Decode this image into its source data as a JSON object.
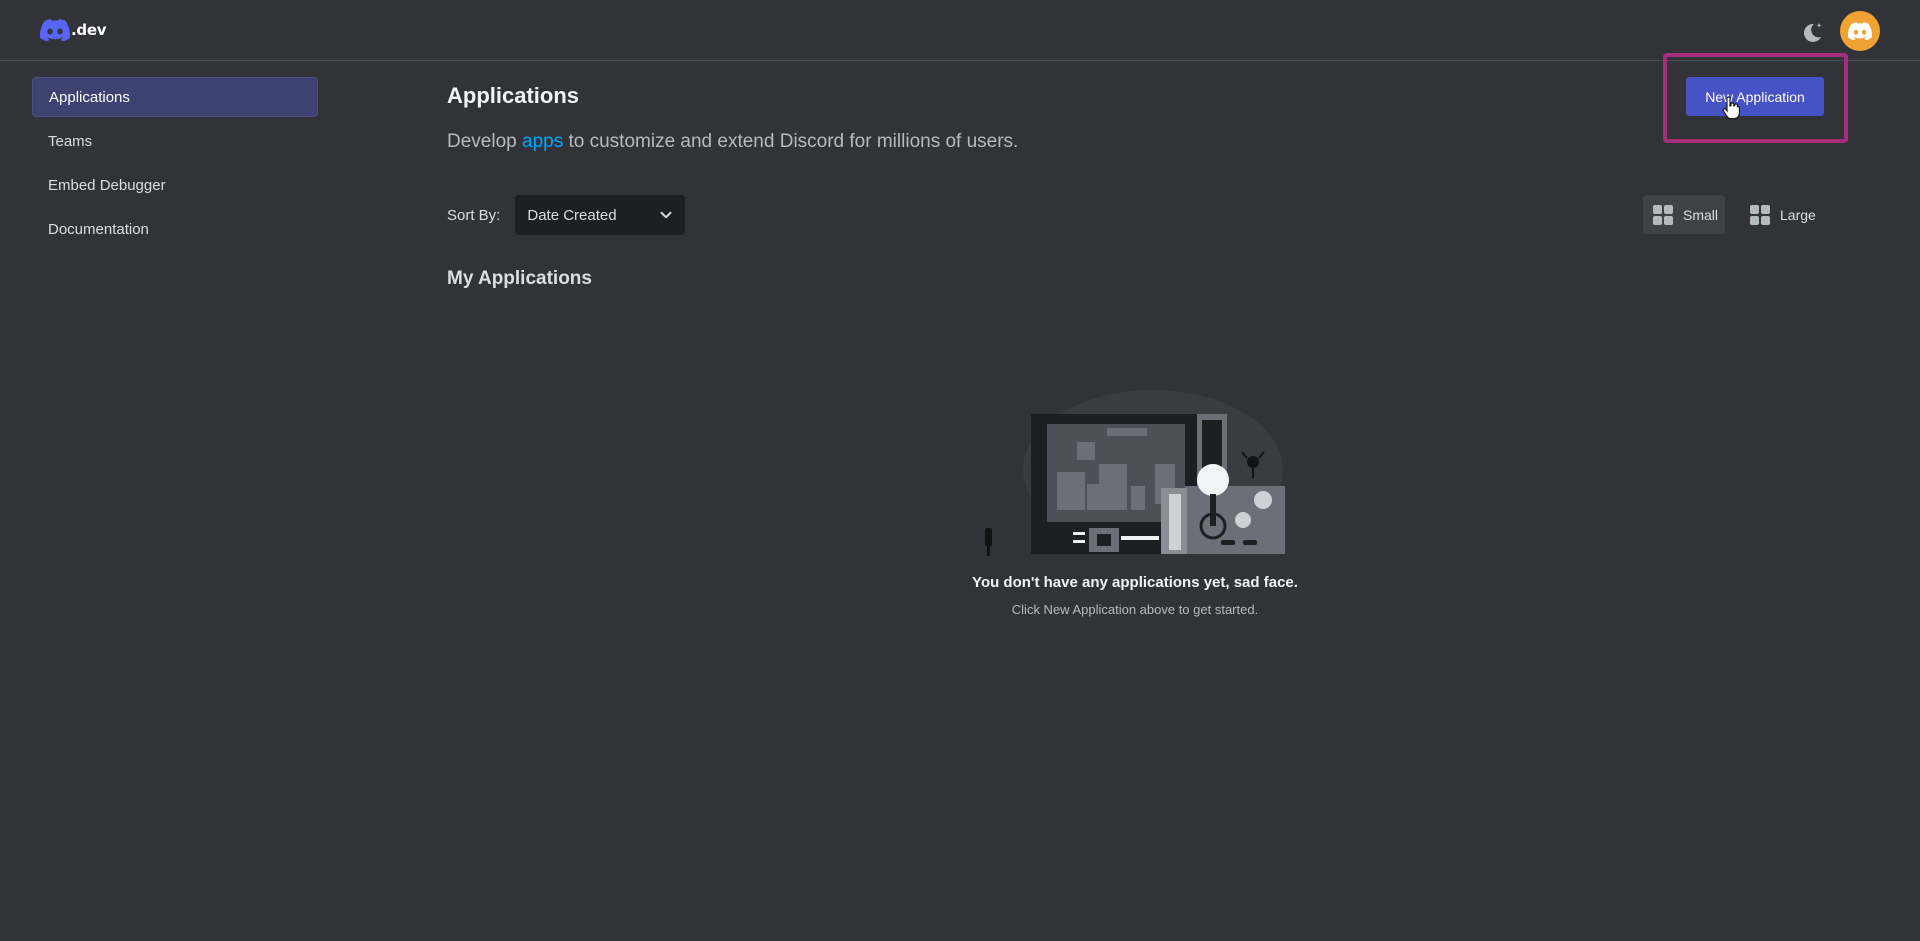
{
  "header": {
    "logo_text": ".dev",
    "logo_icon": "discord-logo-icon",
    "theme_icon": "moon-star-icon",
    "avatar_icon": "discord-avatar-icon"
  },
  "sidebar": {
    "items": [
      {
        "label": "Applications",
        "active": true
      },
      {
        "label": "Teams",
        "active": false
      },
      {
        "label": "Embed Debugger",
        "active": false
      },
      {
        "label": "Documentation",
        "active": false
      }
    ]
  },
  "main": {
    "title": "Applications",
    "subtitle_prefix": "Develop ",
    "subtitle_link": "apps",
    "subtitle_suffix": " to customize and extend Discord for millions of users.",
    "new_app_label": "New Application",
    "sort_label": "Sort By:",
    "sort_value": "Date Created",
    "view_small": "Small",
    "view_large": "Large",
    "section_title": "My Applications",
    "empty_title": "You don't have any applications yet, sad face.",
    "empty_sub": "Click New Application above to get started."
  },
  "colors": {
    "background": "#313338",
    "accent": "#4752c4",
    "link": "#00a8fc",
    "avatar": "#f0a232",
    "highlight": "#a4307b"
  }
}
